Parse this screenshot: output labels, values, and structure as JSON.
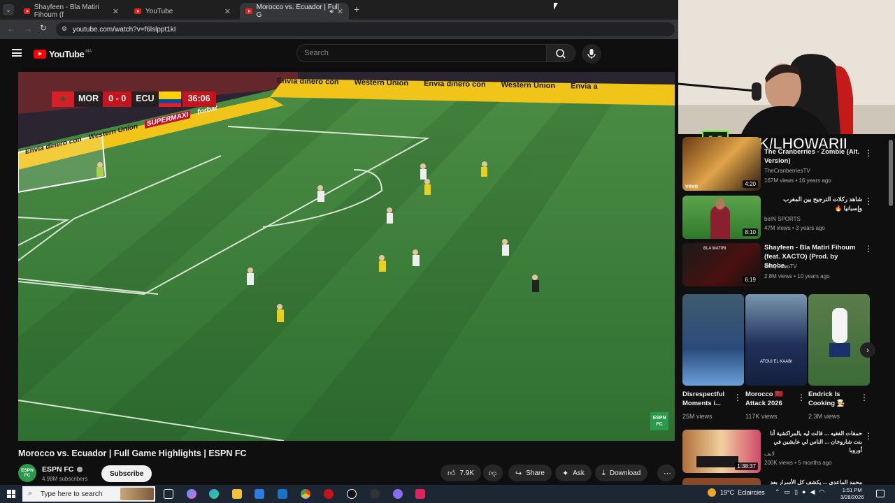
{
  "browser": {
    "tabs": [
      {
        "label": "Shayfeen - Bla Matiri Fihoum (f"
      },
      {
        "label": "YouTube"
      },
      {
        "label": "Morocco vs. Ecuador | Full G"
      }
    ],
    "url": "youtube.com/watch?v=f6lslppt1kI"
  },
  "youtube": {
    "logo_text": "YouTube",
    "region": "MA",
    "search_placeholder": "Search"
  },
  "video": {
    "score_home": "MOR",
    "score": "0 - 0",
    "score_away": "ECU",
    "clock": "36:06",
    "ads": [
      "Envia dinero con",
      "Western Union",
      "Envia dinero con",
      "Western Union",
      "Envia a"
    ],
    "ads_left": [
      "Envia dinero con",
      "Western Union",
      "SUPERMAXI",
      "forbat"
    ],
    "watermark": "ESPN FC",
    "title": "Morocco vs. Ecuador | Full Game Highlights | ESPN FC"
  },
  "channel": {
    "name": "ESPN FC",
    "subscribers": "4.98M subscribers",
    "avatar_text": "ESPN FC",
    "subscribe_label": "Subscribe"
  },
  "actions": {
    "likes": "7.9K",
    "share": "Share",
    "ask": "Ask",
    "download": "Download"
  },
  "overlay": {
    "kick_text": "KICK/LHOWARII",
    "kick_letter": "K"
  },
  "sidebar": {
    "items": [
      {
        "title": "The Cranberries - Zombie (Alt. Version)",
        "channel": "TheCranberriesTV",
        "meta": "167M views • 16 years ago",
        "duration": "4:20",
        "vevo": "vevo"
      },
      {
        "title": "شاهد ركلات الترجيح بين المغرب وإسبانيا 🔥",
        "channel": "beIN SPORTS",
        "meta": "47M views • 3 years ago",
        "duration": "8:10"
      },
      {
        "title": "Shayfeen - Bla Matiri Fihoum (feat. XACTO) (Prod. by Shobe...",
        "channel": "ShayFeenTV",
        "meta": "2.8M views • 10 years ago",
        "duration": "6:19",
        "thumb_text": "BLA MATIRI"
      },
      {
        "title": "حمقات الفقيه ... قالت ليه بالمراكشية أنا بنت شاروخان ... الناس لي عايشين في أوروبا",
        "channel": "لايف",
        "meta": "200K views • 5 months ago",
        "duration": "1:38:37"
      },
      {
        "title": "محمد الماعدي ... يكشف كل الأسرار بعد تعادل",
        "channel": "",
        "meta": "",
        "duration": ""
      }
    ],
    "shorts": [
      {
        "title": "Disrespectful Moments i...",
        "views": "25M views"
      },
      {
        "title": "Morocco 🇲🇦 Attack 2026",
        "views": "117K views",
        "thumb_text": "ATOUI EL KAABI"
      },
      {
        "title": "Endrick Is Cooking 🧑‍🍳",
        "views": "2.3M views"
      }
    ]
  },
  "taskbar": {
    "search_placeholder": "Type here to search",
    "weather": "19°C  Eclaircies",
    "time": "1:51 PM",
    "date": "3/28/2026"
  }
}
